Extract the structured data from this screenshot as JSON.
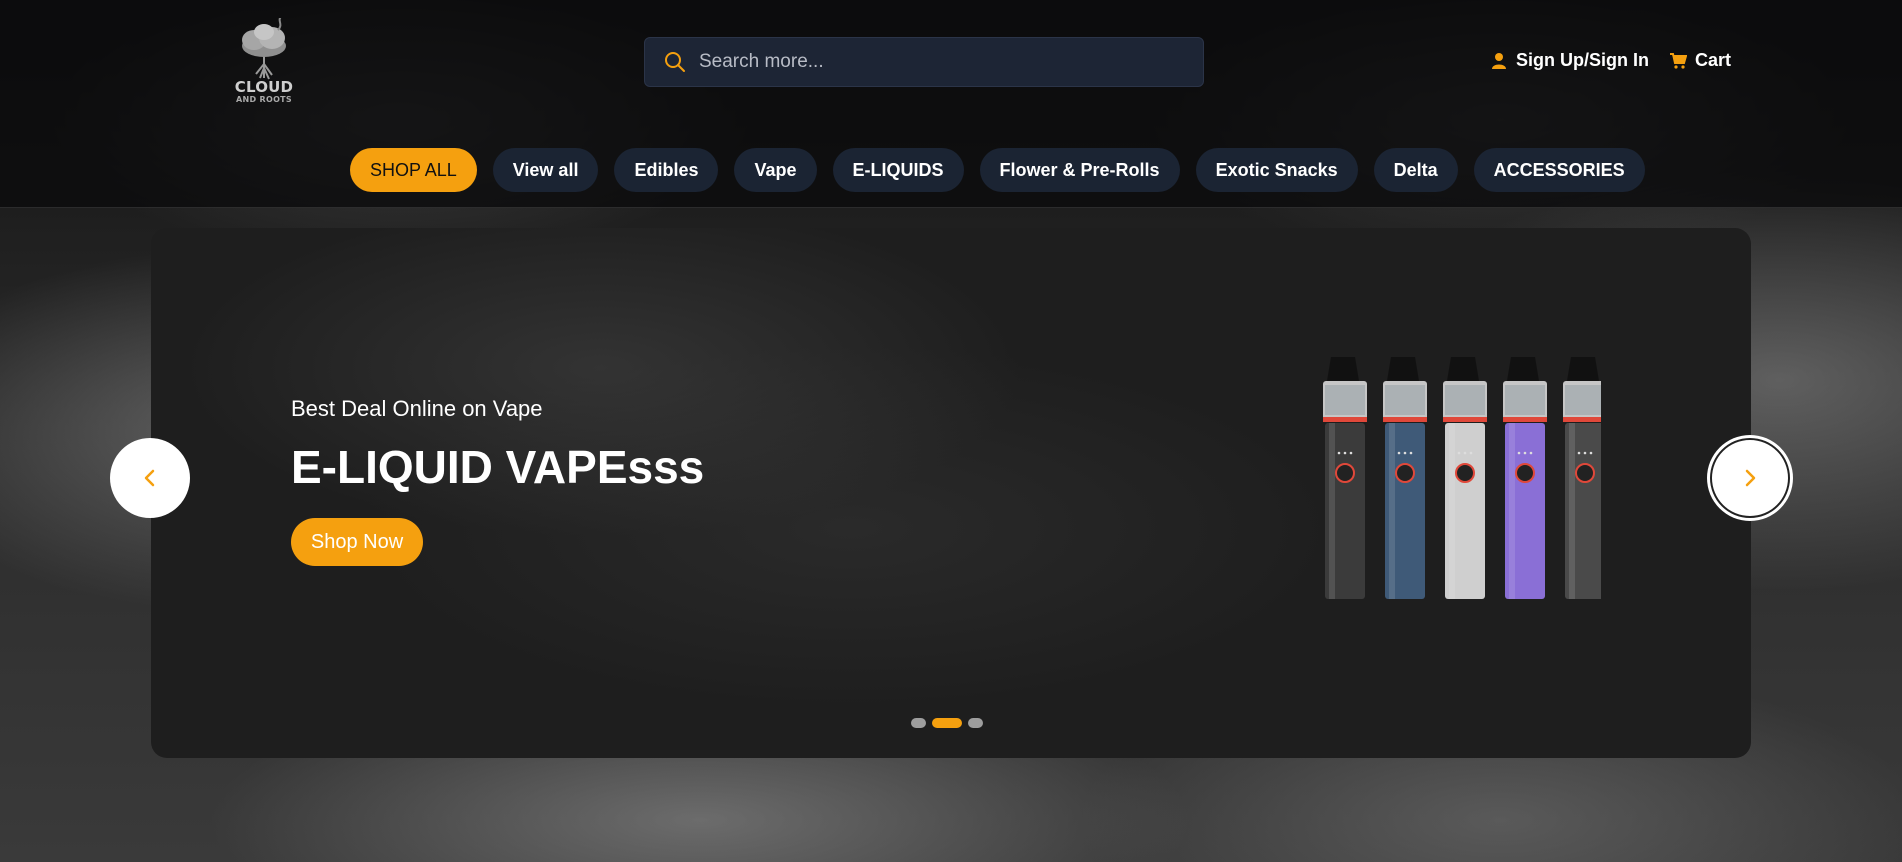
{
  "brand": {
    "name": "CLOUD",
    "tagline": "AND ROOTS"
  },
  "search": {
    "placeholder": "Search more..."
  },
  "user_links": {
    "signin_label": "Sign Up/Sign In",
    "cart_label": "Cart"
  },
  "nav": {
    "items": [
      {
        "label": "SHOP ALL",
        "active": true
      },
      {
        "label": "View all"
      },
      {
        "label": "Edibles"
      },
      {
        "label": "Vape"
      },
      {
        "label": "E-LIQUIDS"
      },
      {
        "label": "Flower & Pre-Rolls"
      },
      {
        "label": "Exotic Snacks"
      },
      {
        "label": "Delta"
      },
      {
        "label": "ACCESSORIES"
      }
    ]
  },
  "hero": {
    "subtitle": "Best Deal Online on Vape",
    "title": "E-LIQUID VAPEsss",
    "cta_label": "Shop Now",
    "pen_colors": [
      "#3b3b3b",
      "#3f5a78",
      "#cfcfcf",
      "#8a6fd6",
      "#4a4a4a"
    ]
  },
  "carousel": {
    "slide_count": 3,
    "active_index": 1
  },
  "colors": {
    "accent": "#f5a00f",
    "pill_bg": "#1b2433",
    "search_bg": "#1d2535"
  }
}
